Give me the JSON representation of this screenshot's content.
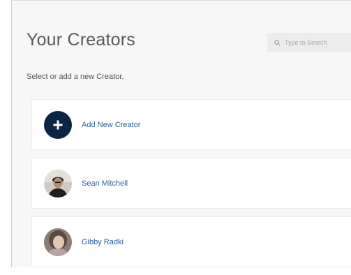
{
  "header": {
    "title": "Your Creators",
    "search_placeholder": "Type to Search"
  },
  "subtitle": "Select or add a new Creator.",
  "creators": [
    {
      "label": "Add New Creator",
      "icon": "plus-icon"
    },
    {
      "label": "Sean Mitchell",
      "icon": "avatar"
    },
    {
      "label": "Gibby Radki",
      "icon": "avatar"
    }
  ],
  "colors": {
    "accent": "#0b2545",
    "link": "#2a5ea8",
    "background": "#f7f7f7"
  }
}
